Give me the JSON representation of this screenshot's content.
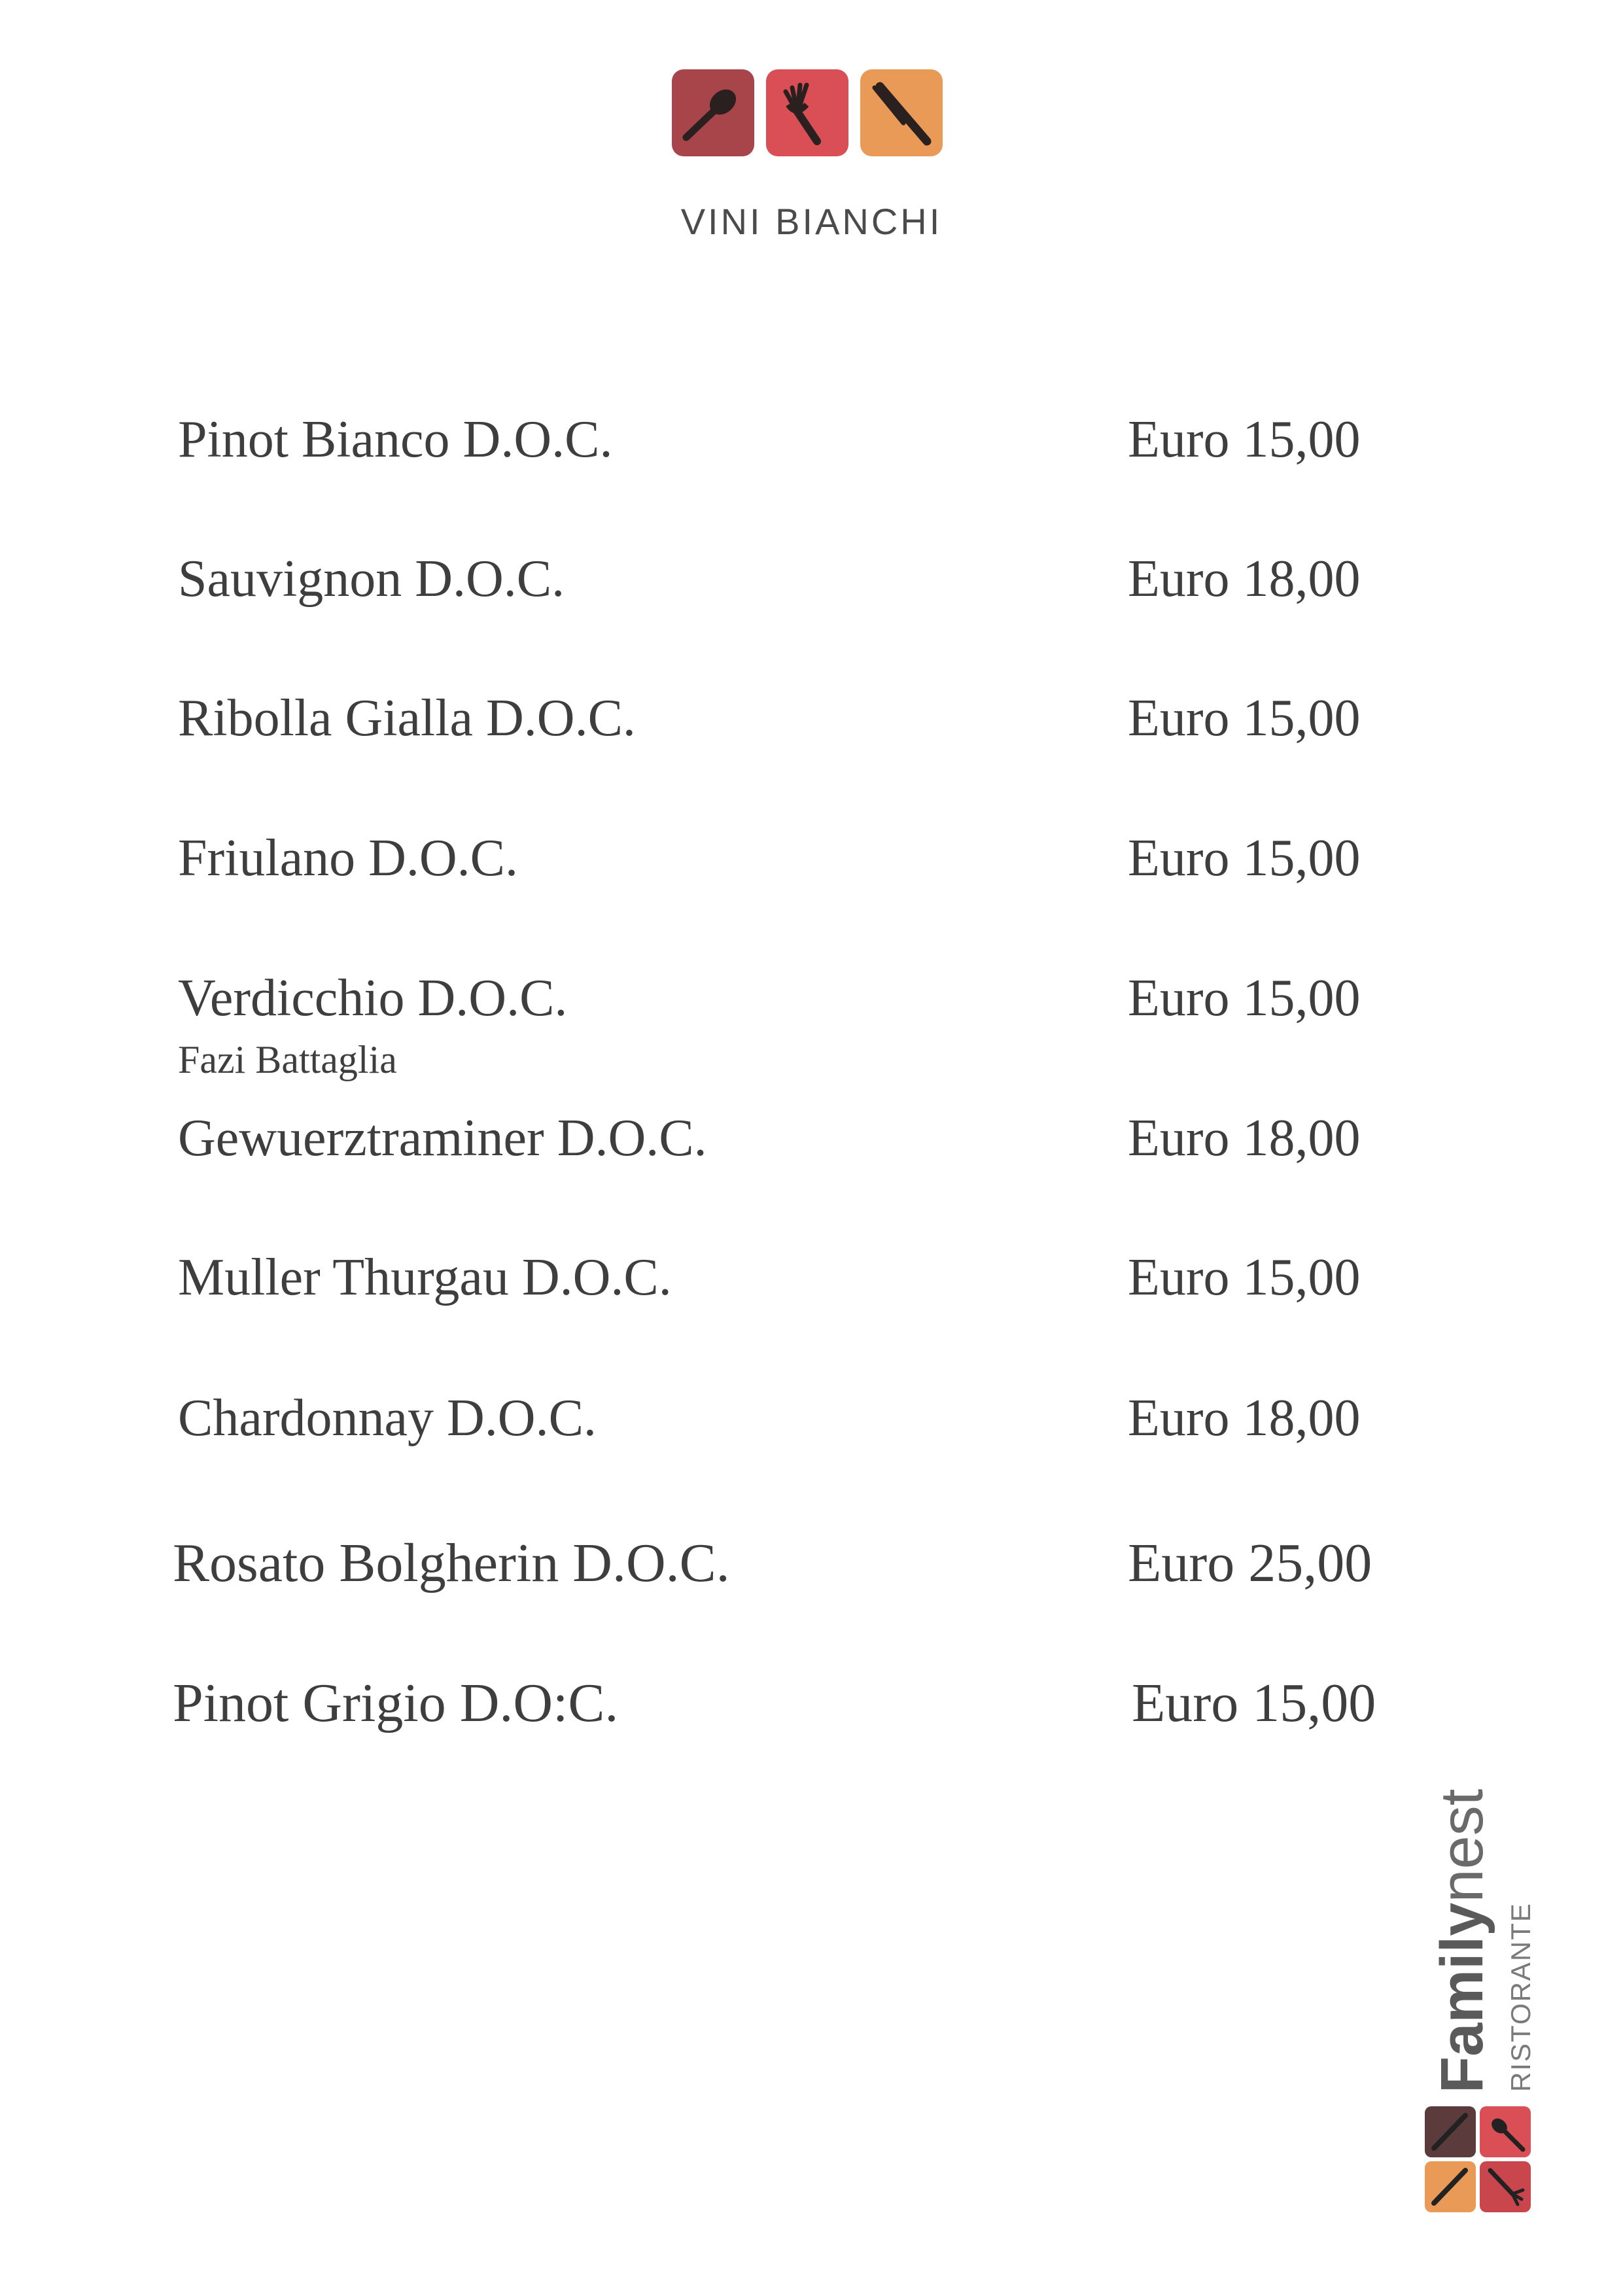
{
  "header": {
    "logo_icons": [
      "spoon-icon",
      "fork-icon",
      "knife-icon"
    ],
    "logo_colors": [
      "#a8454a",
      "#d94f55",
      "#e89a56"
    ],
    "section_title": "VINI BIANCHI"
  },
  "wines": [
    {
      "name": "Pinot Bianco D.O.C.",
      "price": "Euro 15,00"
    },
    {
      "name": "Sauvignon D.O.C.",
      "price": "Euro 18,00"
    },
    {
      "name": "Ribolla Gialla D.O.C.",
      "price": "Euro 15,00"
    },
    {
      "name": "Friulano D.O.C.",
      "price": "Euro 15,00"
    },
    {
      "name": "Verdicchio D.O.C.",
      "price": "Euro 15,00",
      "producer": "Fazi Battaglia"
    },
    {
      "name": "Gewuerztraminer D.O.C.",
      "price": "Euro 18,00"
    },
    {
      "name": "Muller Thurgau D.O.C.",
      "price": "Euro 15,00"
    },
    {
      "name": "Chardonnay D.O.C.",
      "price": "Euro 18,00"
    },
    {
      "name": "Rosato Bolgherin D.O.C.",
      "price": "Euro 25,00"
    },
    {
      "name": "Pinot Grigio D.O:C.",
      "price": "Euro 15,00"
    }
  ],
  "brand": {
    "name_bold": "Family",
    "name_light": "nest",
    "subtitle": "RISTORANTE"
  }
}
